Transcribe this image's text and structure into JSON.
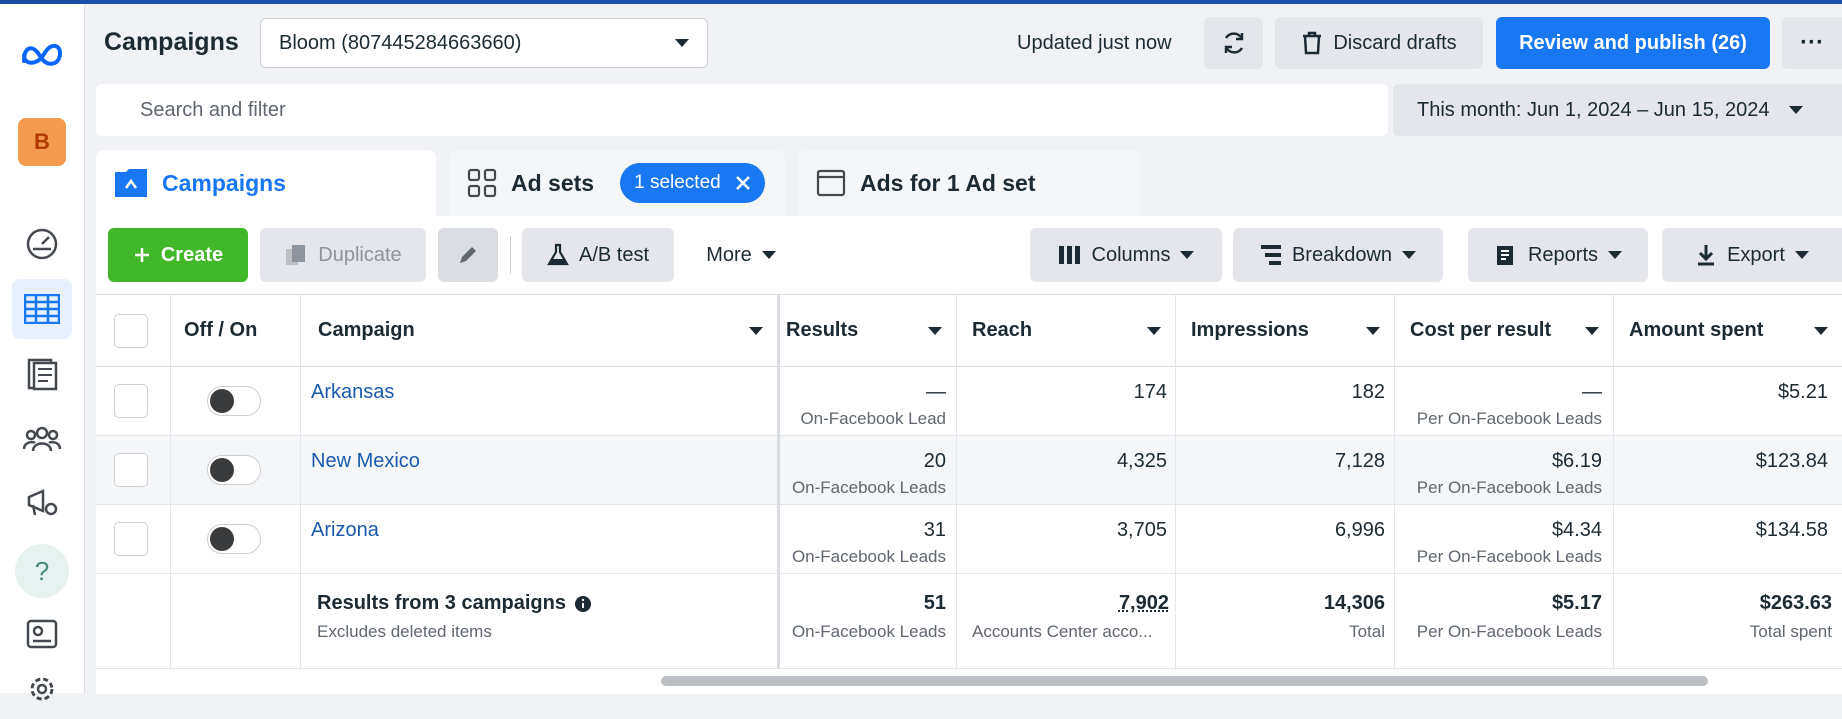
{
  "header": {
    "title": "Campaigns",
    "account": "Bloom (807445284663660)",
    "updated": "Updated just now",
    "discard_label": "Discard drafts",
    "publish_label": "Review and publish (26)",
    "more_label": "···"
  },
  "rail": {
    "avatar_letter": "B",
    "help_label": "?"
  },
  "search": {
    "placeholder": "Search and filter"
  },
  "date_range": "This month: Jun 1, 2024 – Jun 15, 2024",
  "tabs": {
    "campaigns": "Campaigns",
    "adsets": "Ad sets",
    "selected_chip": "1 selected",
    "ads": "Ads for 1 Ad set"
  },
  "toolbar": {
    "create": "Create",
    "duplicate": "Duplicate",
    "abtest": "A/B test",
    "more": "More",
    "columns": "Columns",
    "breakdown": "Breakdown",
    "reports": "Reports",
    "export": "Export"
  },
  "table": {
    "headers": {
      "offon": "Off / On",
      "campaign": "Campaign",
      "results": "Results",
      "reach": "Reach",
      "impressions": "Impressions",
      "cost": "Cost per result",
      "spent": "Amount spent"
    },
    "rows": [
      {
        "name": "Arkansas",
        "results": "—",
        "results_sub": "On-Facebook Lead",
        "reach": "174",
        "impressions": "182",
        "cost": "—",
        "cost_sub": "Per On-Facebook Leads",
        "spent": "$5.21"
      },
      {
        "name": "New Mexico",
        "results": "20",
        "results_sub": "On-Facebook Leads",
        "reach": "4,325",
        "impressions": "7,128",
        "cost": "$6.19",
        "cost_sub": "Per On-Facebook Leads",
        "spent": "$123.84"
      },
      {
        "name": "Arizona",
        "results": "31",
        "results_sub": "On-Facebook Leads",
        "reach": "3,705",
        "impressions": "6,996",
        "cost": "$4.34",
        "cost_sub": "Per On-Facebook Leads",
        "spent": "$134.58"
      }
    ],
    "summary": {
      "title": "Results from 3 campaigns",
      "subtitle": "Excludes deleted items",
      "results": "51",
      "results_sub": "On-Facebook Leads",
      "reach": "7,902",
      "reach_sub": "Accounts Center acco...",
      "impressions": "14,306",
      "impressions_sub": "Total",
      "cost": "$5.17",
      "cost_sub": "Per On-Facebook Leads",
      "spent": "$263.63",
      "spent_sub": "Total spent"
    }
  },
  "colors": {
    "accent": "#1877f2",
    "create_green": "#42b72a",
    "link": "#1a5aad"
  }
}
